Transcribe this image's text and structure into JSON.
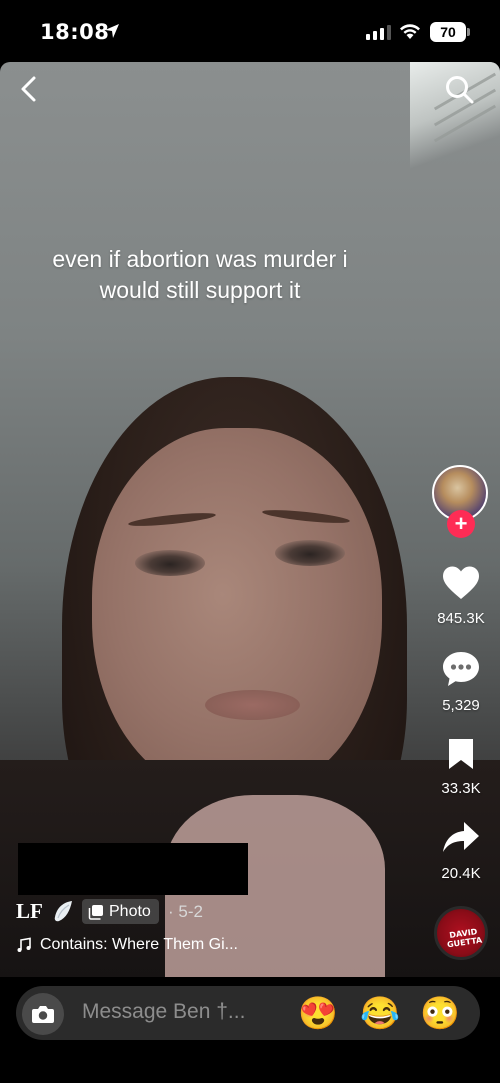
{
  "status_bar": {
    "time": "18:08",
    "battery": "70",
    "icons": [
      "location-arrow-icon",
      "cellular-signal-icon",
      "wifi-icon",
      "battery-icon"
    ]
  },
  "header": {
    "back_icon": "chevron-left-icon",
    "search_icon": "search-icon"
  },
  "post": {
    "overlay_text": "even if abortion was murder i would still support it",
    "author": "LF",
    "author_emoji": "wing-icon",
    "type_label": "Photo",
    "date": "· 5-2",
    "music": "Contains: Where Them Gi...",
    "music_disc_text": "DAVID GUETTA"
  },
  "actions": {
    "likes": "845.3K",
    "comments": "5,329",
    "bookmarks": "33.3K",
    "shares": "20.4K",
    "follow_symbol": "+"
  },
  "composer": {
    "placeholder": "Message Ben †...",
    "emojis": [
      "😍",
      "😂",
      "😳"
    ]
  },
  "colors": {
    "accent": "#fe2c55",
    "composer_bg": "#2b2b2b"
  }
}
